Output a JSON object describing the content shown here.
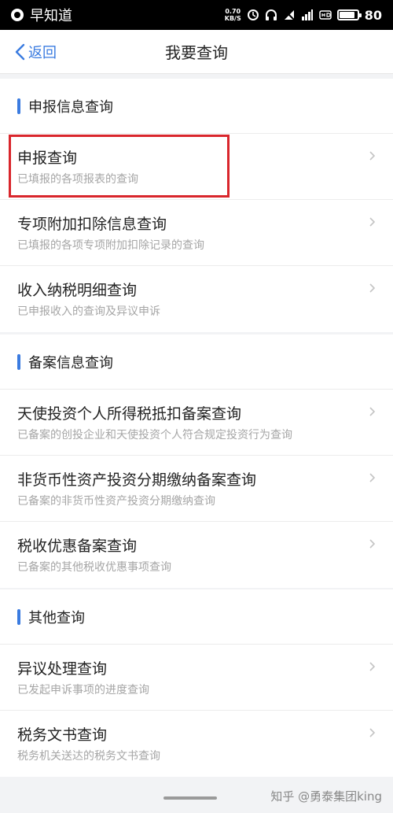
{
  "status_bar": {
    "app_name": "早知道",
    "speed_value": "0.70",
    "speed_unit": "KB/S",
    "battery": "80"
  },
  "nav": {
    "back_label": "返回",
    "title": "我要查询"
  },
  "sections": [
    {
      "title": "申报信息查询",
      "items": [
        {
          "title": "申报查询",
          "subtitle": "已填报的各项报表的查询"
        },
        {
          "title": "专项附加扣除信息查询",
          "subtitle": "已填报的各项专项附加扣除记录的查询"
        },
        {
          "title": "收入纳税明细查询",
          "subtitle": "已申报收入的查询及异议申诉"
        }
      ]
    },
    {
      "title": "备案信息查询",
      "items": [
        {
          "title": "天使投资个人所得税抵扣备案查询",
          "subtitle": "已备案的创投企业和天使投资个人符合规定投资行为查询"
        },
        {
          "title": "非货币性资产投资分期缴纳备案查询",
          "subtitle": "已备案的非货币性资产投资分期缴纳查询"
        },
        {
          "title": "税收优惠备案查询",
          "subtitle": "已备案的其他税收优惠事项查询"
        }
      ]
    },
    {
      "title": "其他查询",
      "items": [
        {
          "title": "异议处理查询",
          "subtitle": "已发起申诉事项的进度查询"
        },
        {
          "title": "税务文书查询",
          "subtitle": "税务机关送达的税务文书查询"
        }
      ]
    }
  ],
  "watermark": "知乎 @勇泰集团king",
  "colors": {
    "accent": "#3a7be0",
    "highlight": "#d9262c"
  }
}
